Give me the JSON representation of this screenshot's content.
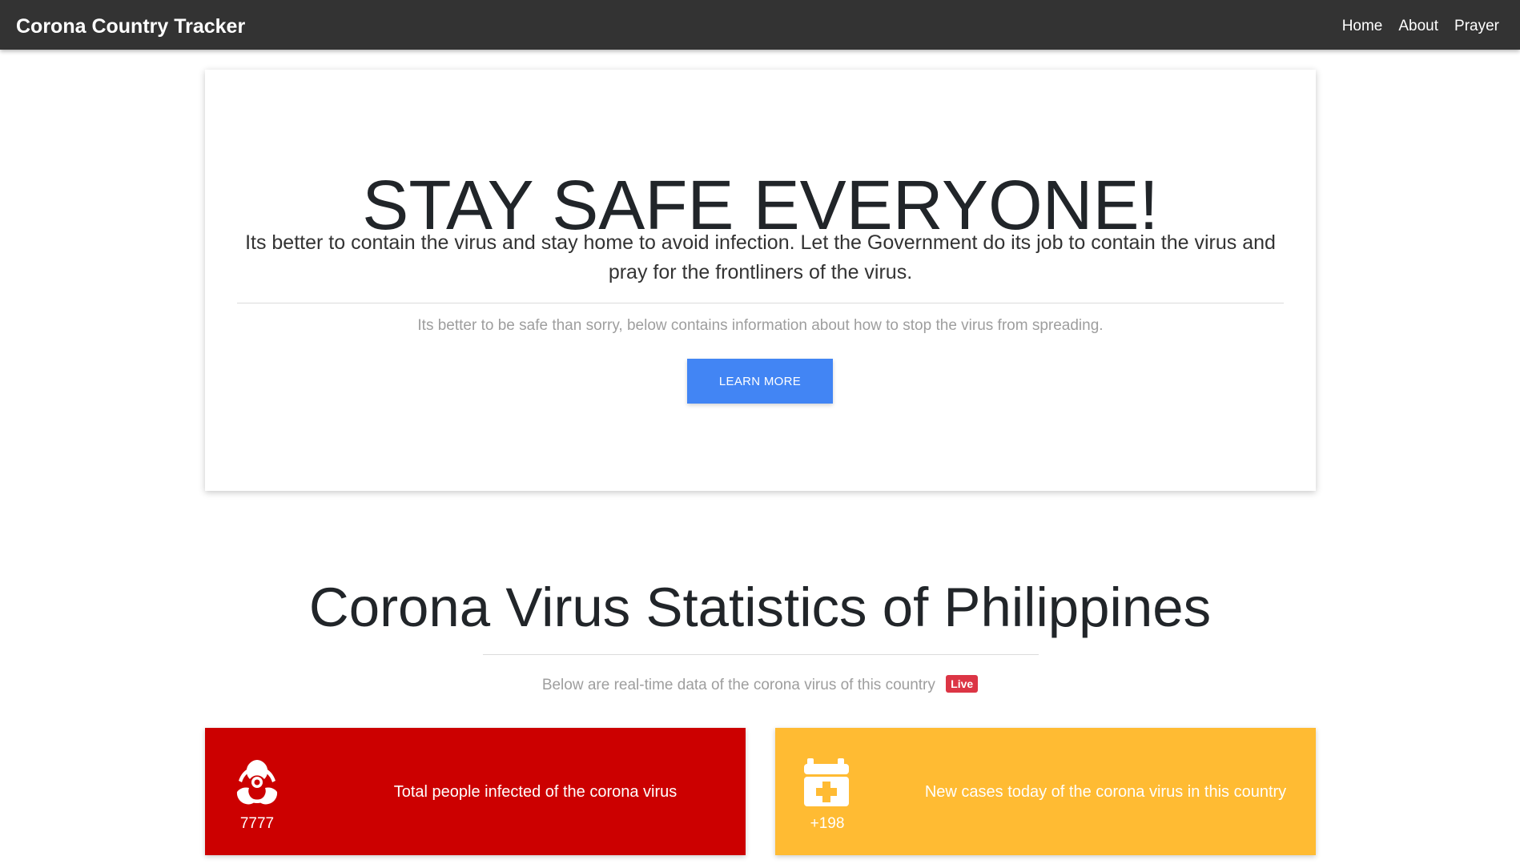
{
  "navbar": {
    "brand": "Corona Country Tracker",
    "links": [
      "Home",
      "About",
      "Prayer"
    ]
  },
  "jumbotron": {
    "heading": "STAY SAFE EVERYONE!",
    "lead": "Its better to contain the virus and stay home to avoid infection. Let the Government do its job to contain the virus and pray for the frontliners of the virus.",
    "subtext": "Its better to be safe than sorry, below contains information about how to stop the virus from spreading.",
    "button_label": "LEARN MORE"
  },
  "stats": {
    "title": "Corona Virus Statistics of Philippines",
    "subtitle": "Below are real-time data of the corona virus of this country",
    "badge": "Live",
    "cards": [
      {
        "value": "7777",
        "description": "Total people infected of the corona virus",
        "icon": "biohazard-icon",
        "color": "#cc0000"
      },
      {
        "value": "+198",
        "description": "New cases today of the corona virus in this country",
        "icon": "calendar-plus-icon",
        "color": "#ffbb33"
      }
    ]
  }
}
